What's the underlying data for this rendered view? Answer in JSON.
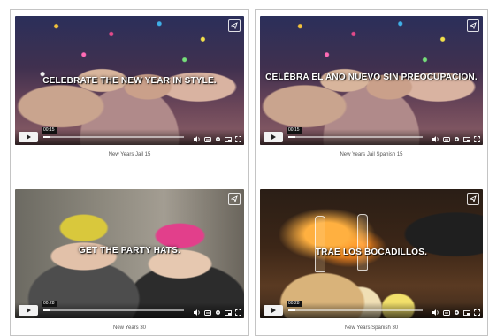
{
  "videos": [
    {
      "title": "New Years Jail 15",
      "overlay_text": "CELEBRATE THE NEW YEAR IN STYLE.",
      "time": "00:15",
      "progress": 0.05
    },
    {
      "title": "New Years Jail Spanish 15",
      "overlay_text": "CELEBRA EL ANO NUEVO SIN PREOCUPACION.",
      "time": "00:15",
      "progress": 0.05
    },
    {
      "title": "New Years 30",
      "overlay_text": "GET THE PARTY HATS.",
      "time": "00:28",
      "progress": 0.05
    },
    {
      "title": "New Years Spanish 30",
      "overlay_text": "TRAE LOS BOCADILLOS.",
      "time": "00:28",
      "progress": 0.05
    }
  ]
}
